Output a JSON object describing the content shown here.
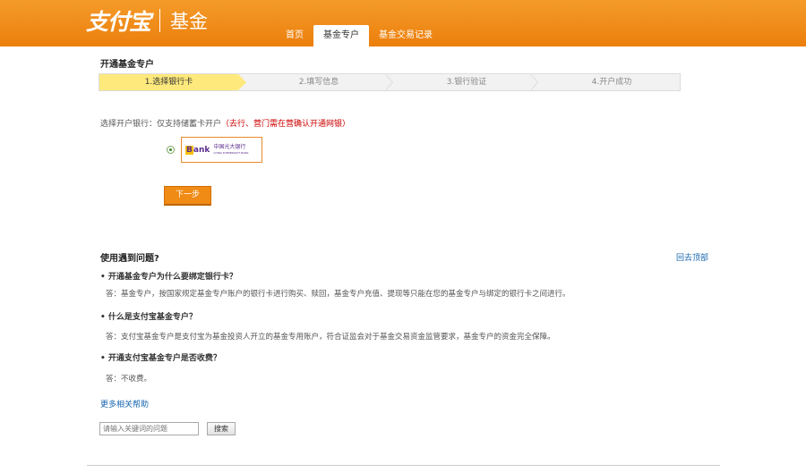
{
  "header": {
    "brand": "支付宝",
    "section": "基金",
    "tabs": [
      {
        "label": "首页",
        "active": false
      },
      {
        "label": "基金专户",
        "active": true
      },
      {
        "label": "基金交易记录",
        "active": false
      }
    ]
  },
  "page_title": "开通基金专户",
  "steps": [
    {
      "label": "1.选择银行卡",
      "active": true
    },
    {
      "label": "2.填写信息",
      "active": false
    },
    {
      "label": "3.银行验证",
      "active": false
    },
    {
      "label": "4.开户成功",
      "active": false
    }
  ],
  "bank_select": {
    "prompt": "选择开户银行：仅支持储蓄卡开户",
    "note": "（去行、营门需在营确认开通网银）",
    "bank": {
      "logo_text": "Bank",
      "name_cn": "中国光大银行",
      "name_en": "CHINA EVERBRIGHT BANK",
      "selected": true
    }
  },
  "next_button": "下一步",
  "faq": {
    "title": "使用遇到问题?",
    "back_link": "回去顶部",
    "items": [
      {
        "q": "• 开通基金专户为什么要绑定银行卡？",
        "a": "答：基金专户，按国家规定基金专户账户的银行卡进行购买、赎回，基金专户充值、提现等只能在您的基金专户与绑定的银行卡之间进行。"
      },
      {
        "q": "• 什么是支付宝基金专户？",
        "a": "答：支付宝基金专户是支付宝为基金投资人开立的基金专用账户，符合证监会对于基金交易资金监管要求，基金专户的资金完全保障。"
      },
      {
        "q": "• 开通支付宝基金专户是否收费？",
        "a": "答：不收费。"
      }
    ],
    "more_help": "更多相关帮助"
  },
  "search": {
    "placeholder": "请输入关键词的问题",
    "button": "搜索"
  },
  "colors": {
    "header": "#ef8a1a",
    "accent": "#f08b16",
    "link": "#1766b0",
    "step_active": "#fde97c",
    "note": "#cc0000"
  }
}
